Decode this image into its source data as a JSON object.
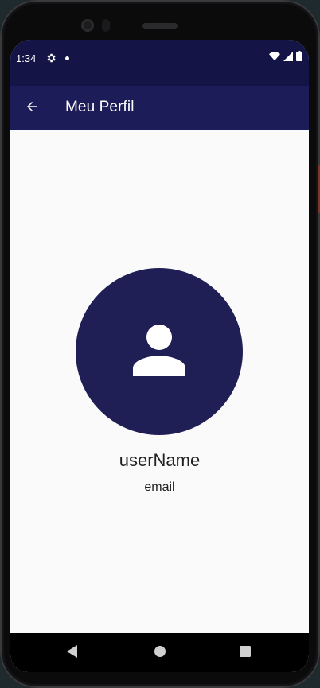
{
  "status_bar": {
    "time": "1:34",
    "icons": [
      "gear-icon",
      "notification-dot-icon",
      "wifi-icon",
      "signal-icon",
      "battery-icon"
    ]
  },
  "app_bar": {
    "title": "Meu Perfil",
    "back_icon": "arrow-back-icon"
  },
  "profile": {
    "avatar_icon": "person-icon",
    "username": "userName",
    "email": "email"
  },
  "nav_bar": {
    "buttons": [
      "back-triangle-icon",
      "home-circle-icon",
      "recents-square-icon"
    ]
  },
  "colors": {
    "status_bar": "#141447",
    "app_bar": "#1c1c58",
    "avatar": "#1f1f56",
    "background": "#fafafa",
    "text": "#212121"
  }
}
